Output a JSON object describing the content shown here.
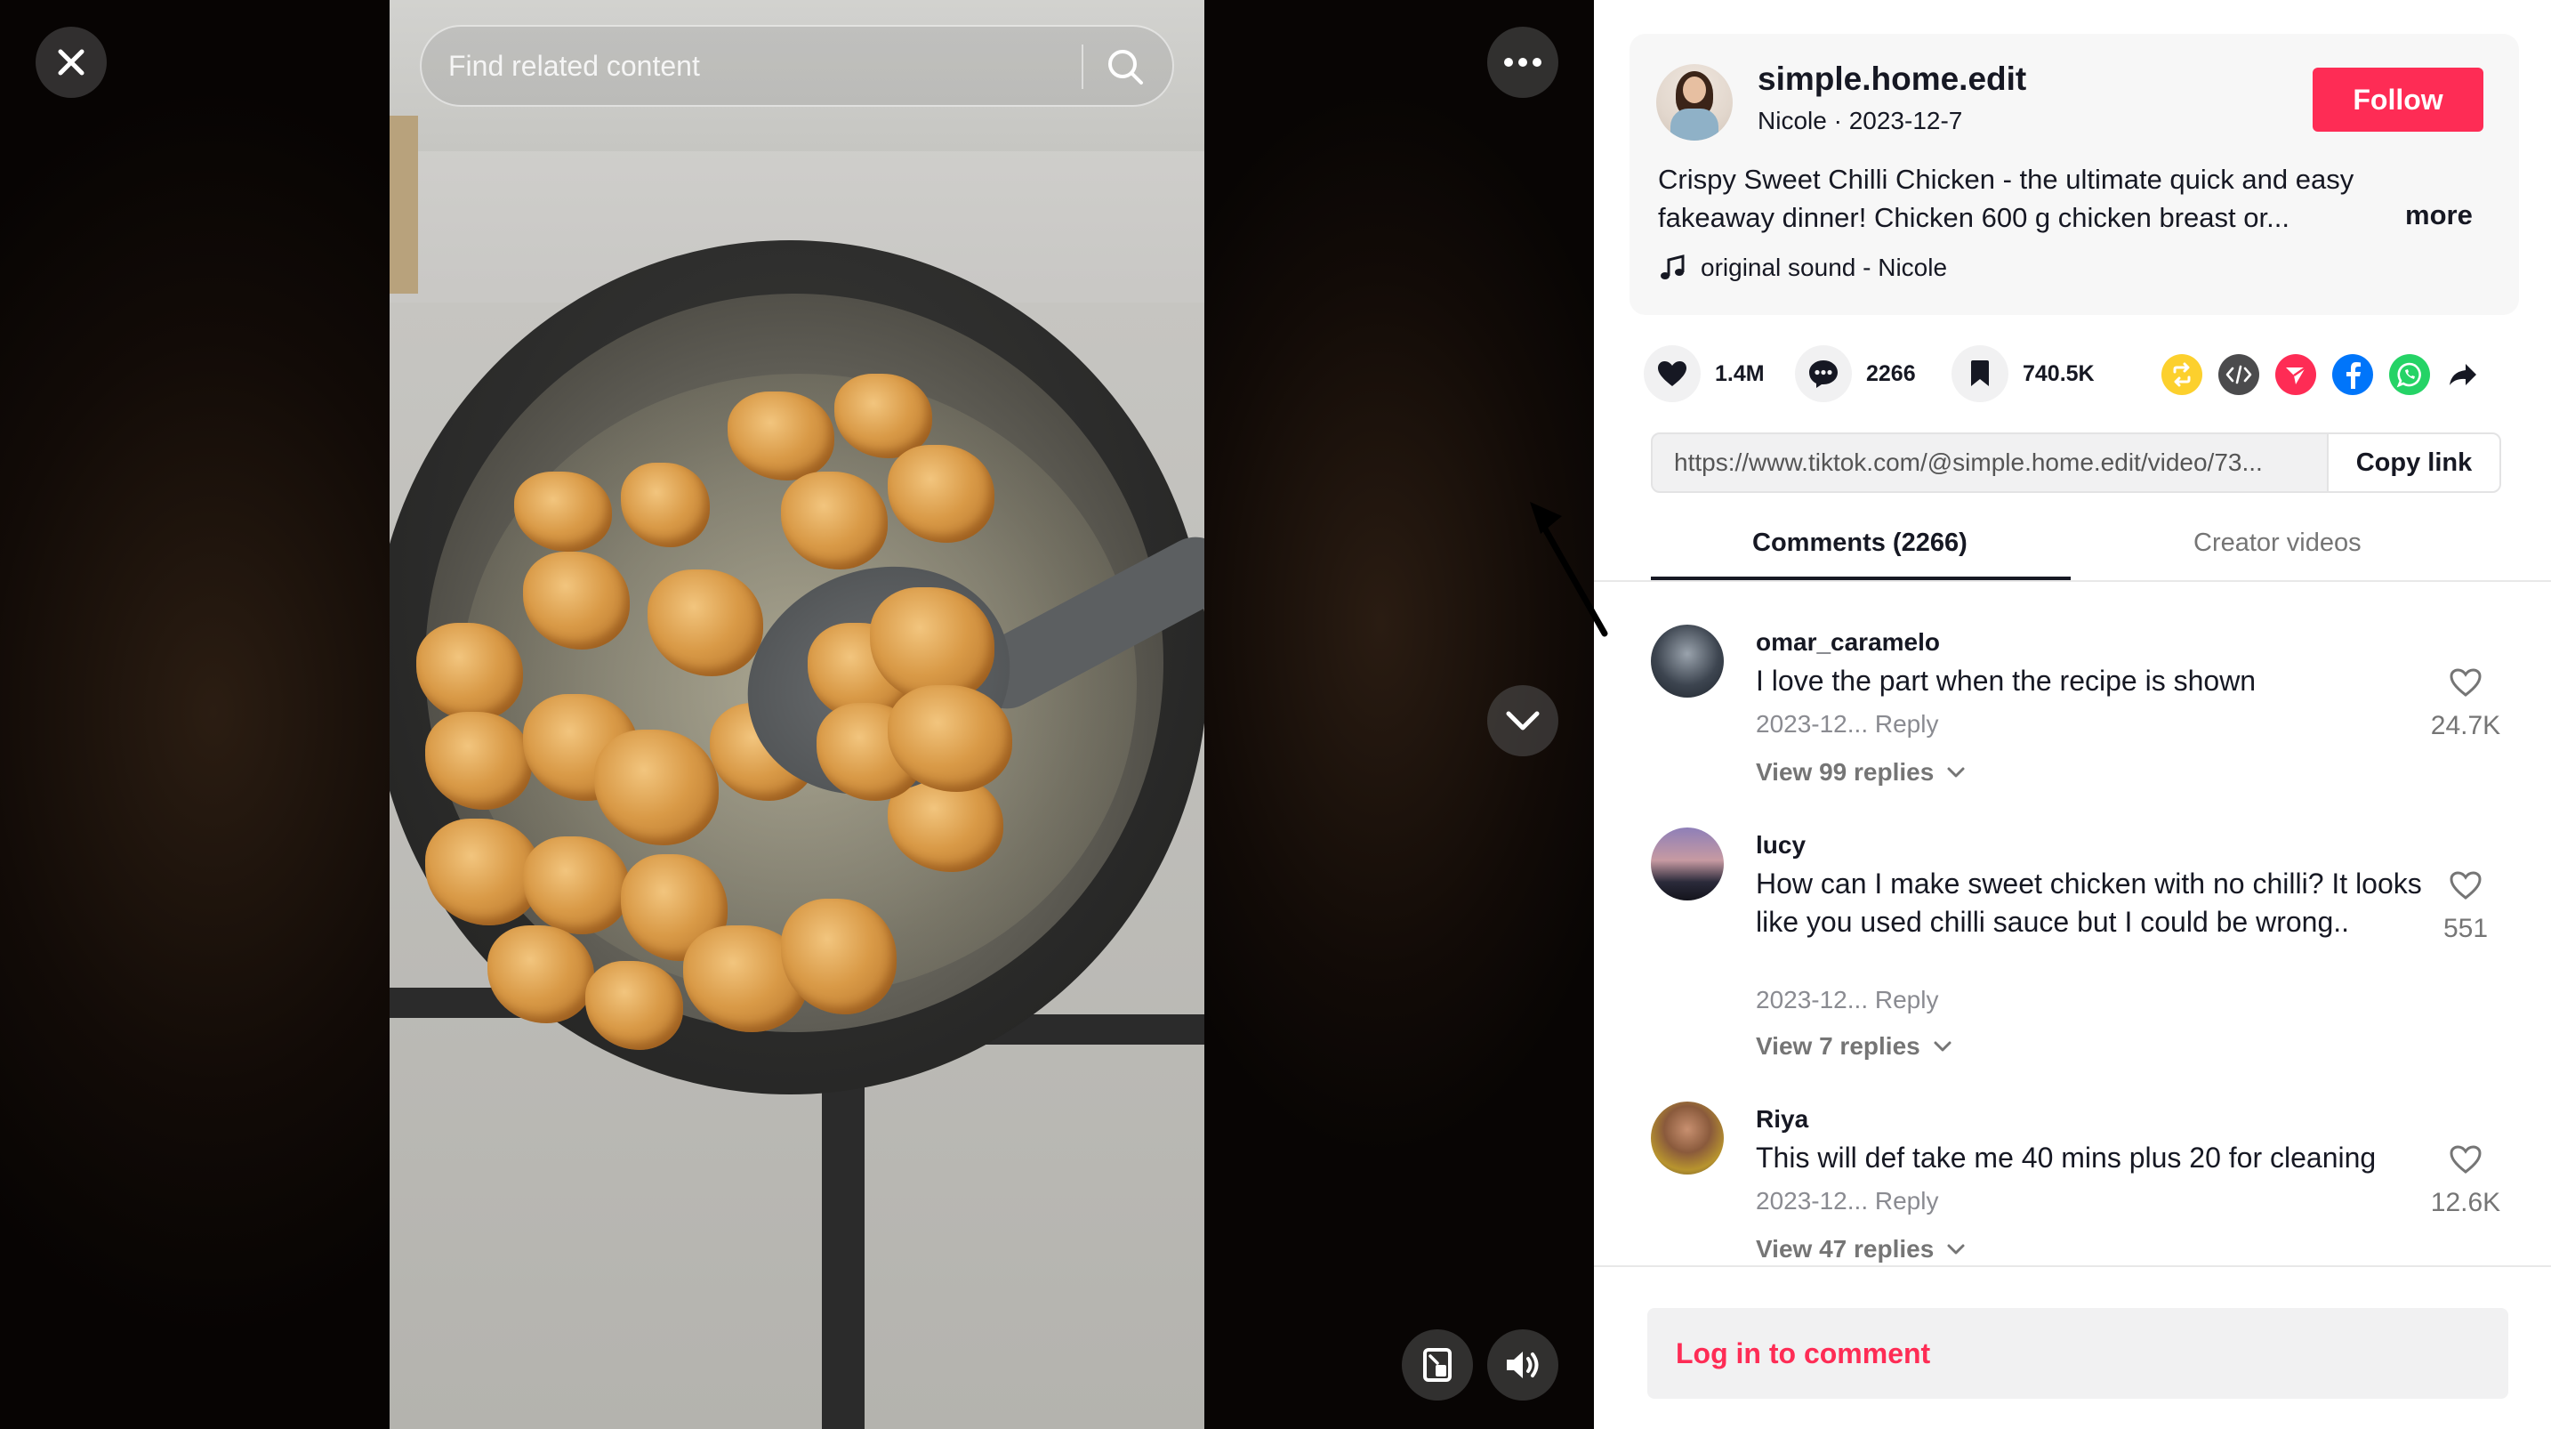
{
  "video": {
    "search_placeholder": "Find related content"
  },
  "post": {
    "username": "simple.home.edit",
    "display_name": "Nicole",
    "date": "2023-12-7",
    "separator": " · ",
    "follow_label": "Follow",
    "description": "Crispy Sweet Chilli Chicken - the ultimate quick and easy fakeaway dinner! Chicken 600 g chicken breast or...",
    "more_label": "more",
    "sound": "original sound - Nicole"
  },
  "actions": {
    "likes": "1.4M",
    "comments": "2266",
    "saves": "740.5K"
  },
  "share": {
    "link": "https://www.tiktok.com/@simple.home.edit/video/73...",
    "copy_label": "Copy link"
  },
  "tabs": {
    "comments": "Comments (2266)",
    "creator_videos": "Creator videos"
  },
  "comments": [
    {
      "user": "omar_caramelo",
      "text": "I love the part when the recipe is shown",
      "date": "2023-12...",
      "reply_label": "Reply",
      "likes": "24.7K",
      "replies": "View 99 replies"
    },
    {
      "user": "lucy",
      "text": "How can I make sweet chicken with no chilli? It looks like you used chilli sauce but I could be wrong..",
      "date": "2023-12...",
      "reply_label": "Reply",
      "likes": "551",
      "replies": "View 7 replies"
    },
    {
      "user": "Riya",
      "text": "This will def take me 40 mins plus 20 for cleaning",
      "date": "2023-12...",
      "reply_label": "Reply",
      "likes": "12.6K",
      "replies": "View 47 replies"
    }
  ],
  "login_prompt": "Log in to comment",
  "colors": {
    "accent": "#fe2c55",
    "text": "#161823",
    "muted": "#8a8b91"
  }
}
